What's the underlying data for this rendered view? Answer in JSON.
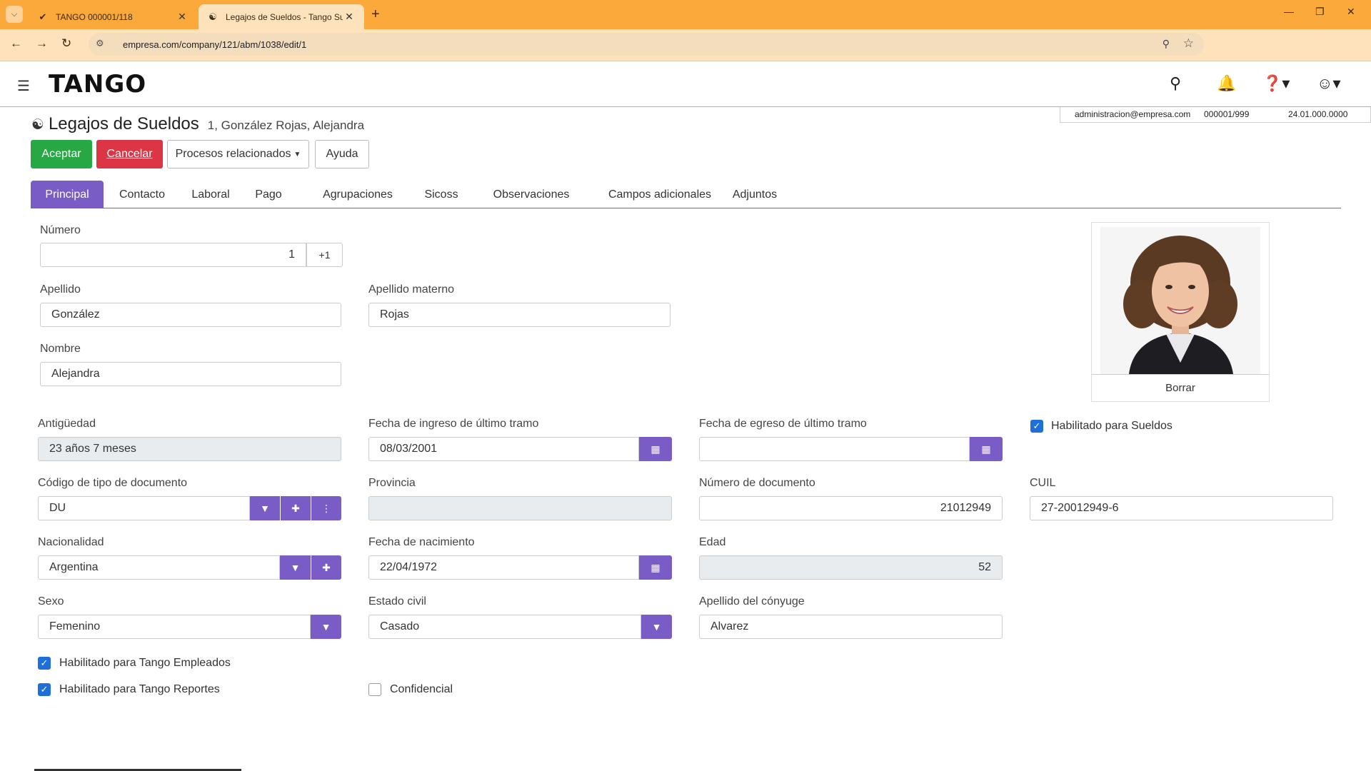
{
  "browser": {
    "tabs": [
      {
        "title": "TANGO 000001/118"
      },
      {
        "title": "Legajos de Sueldos - Tango Sue"
      }
    ],
    "url": "empresa.com/company/121/abm/1038/edit/1"
  },
  "header": {
    "logo": "TANGO"
  },
  "info": {
    "email": "administracion@empresa.com",
    "company": "000001/999",
    "version": "24.01.000.0000"
  },
  "page": {
    "title": "Legajos de Sueldos",
    "subtitle": "1, González Rojas, Alejandra"
  },
  "actions": {
    "accept": "Aceptar",
    "cancel": "Cancelar",
    "related": "Procesos relacionados",
    "help": "Ayuda"
  },
  "tabs": [
    "Principal",
    "Contacto",
    "Laboral",
    "Pago",
    "Agrupaciones",
    "Sicoss",
    "Observaciones",
    "Campos adicionales",
    "Adjuntos"
  ],
  "form": {
    "numero": {
      "label": "Número",
      "value": "1",
      "addon": "+1"
    },
    "apellido": {
      "label": "Apellido",
      "value": "González"
    },
    "apellido_materno": {
      "label": "Apellido materno",
      "value": "Rojas"
    },
    "nombre": {
      "label": "Nombre",
      "value": "Alejandra"
    },
    "antiguedad": {
      "label": "Antigüedad",
      "value": "23 años 7 meses"
    },
    "fecha_ingreso": {
      "label": "Fecha de ingreso de último tramo",
      "value": "08/03/2001"
    },
    "fecha_egreso": {
      "label": "Fecha de egreso de último tramo",
      "value": ""
    },
    "habilitado_sueldos": {
      "label": "Habilitado para Sueldos",
      "checked": true
    },
    "tipo_documento": {
      "label": "Código de tipo de documento",
      "value": "DU"
    },
    "provincia": {
      "label": "Provincia",
      "value": ""
    },
    "numero_documento": {
      "label": "Número de documento",
      "value": "21012949"
    },
    "cuil": {
      "label": "CUIL",
      "value": "27-20012949-6"
    },
    "nacionalidad": {
      "label": "Nacionalidad",
      "value": "Argentina"
    },
    "fecha_nacimiento": {
      "label": "Fecha de nacimiento",
      "value": "22/04/1972"
    },
    "edad": {
      "label": "Edad",
      "value": "52"
    },
    "sexo": {
      "label": "Sexo",
      "value": "Femenino"
    },
    "estado_civil": {
      "label": "Estado civil",
      "value": "Casado"
    },
    "apellido_conyuge": {
      "label": "Apellido del cónyuge",
      "value": "Alvarez"
    },
    "habilitado_empleados": {
      "label": "Habilitado para Tango Empleados",
      "checked": true
    },
    "habilitado_reportes": {
      "label": "Habilitado para Tango Reportes",
      "checked": true
    },
    "confidencial": {
      "label": "Confidencial",
      "checked": false
    }
  },
  "photo": {
    "delete_label": "Borrar"
  },
  "colors": {
    "accent": "#7a5cc6",
    "accept": "#28a745",
    "cancel": "#dc3545",
    "checkbox": "#1e6fd9",
    "browser": "#fba93a"
  }
}
